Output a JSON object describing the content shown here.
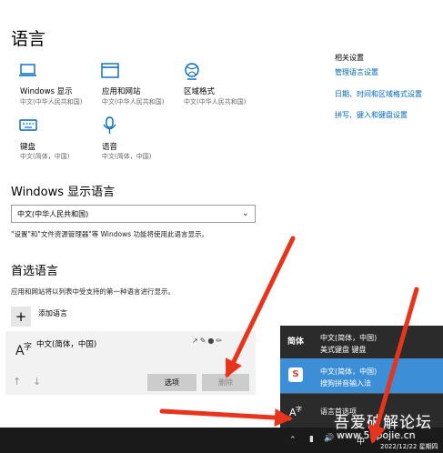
{
  "page": {
    "title": "语言"
  },
  "tiles": [
    {
      "icon": "display-icon",
      "label": "Windows 显示",
      "sub": "中文(中华人民共和国)"
    },
    {
      "icon": "apps-window-icon",
      "label": "应用和网站",
      "sub": "中文(中华人民共和国)"
    },
    {
      "icon": "region-globe-icon",
      "label": "区域格式",
      "sub": "中文(中华人民共和国)"
    },
    {
      "icon": "keyboard-icon",
      "label": "键盘",
      "sub": "中文(简体，中国)"
    },
    {
      "icon": "microphone-icon",
      "label": "语音",
      "sub": "中文(简体，中国)"
    }
  ],
  "related": {
    "heading": "相关设置",
    "links": [
      "管理语言设置",
      "日期、时间和区域格式设置",
      "拼写、键入和键盘设置"
    ]
  },
  "display_language": {
    "heading": "Windows 显示语言",
    "value": "中文(中华人民共和国)",
    "note": "\"设置\"和\"文件资源管理器\"等 Windows 功能将使用此语言显示。"
  },
  "preferred": {
    "heading": "首选语言",
    "desc": "应用和网站将以列表中受支持的第一种语言进行显示。",
    "add_label": "添加语言",
    "item_name": "中文(简体，中国)",
    "options_label": "选项",
    "remove_label": "删除"
  },
  "flyout": {
    "items": [
      {
        "badge": "简体",
        "line1": "中文(简体，中国)",
        "line2": "美式键盘 键盘",
        "selected": false
      },
      {
        "badge": "S",
        "line1": "中文(简体，中国)",
        "line2": "搜狗拼音输入法",
        "selected": true
      }
    ],
    "prefs_label": "语言首选项"
  },
  "watermark": {
    "line1": "吾爱破解论坛",
    "line2": "www.52pojie.cn"
  },
  "taskbar": {
    "ime": "中",
    "date": "2022/12/22 星期四"
  },
  "colors": {
    "accent": "#0067c0",
    "flyout_bg": "#2b2b2b",
    "flyout_selected": "#3c8fd6",
    "arrow": "#e8341c"
  }
}
